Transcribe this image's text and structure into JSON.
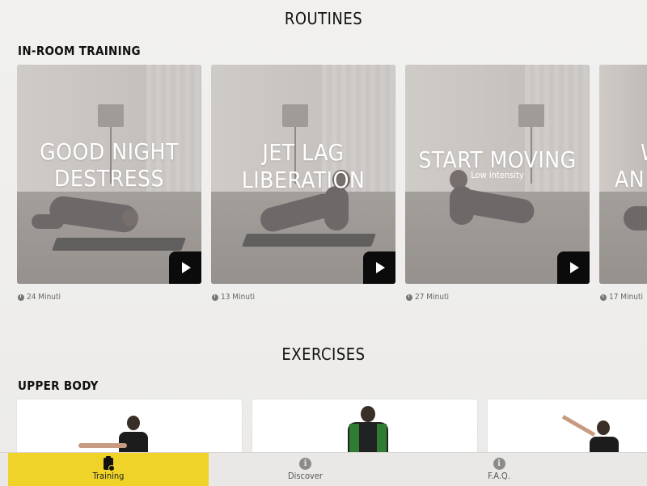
{
  "routines": {
    "title": "ROUTINES",
    "subtitle": "IN-ROOM TRAINING",
    "cards": [
      {
        "title_line1": "GOOD NIGHT",
        "title_line2": "DESTRESS",
        "subtitle": "",
        "duration": "24 Minuti"
      },
      {
        "title_line1": "JET LAG",
        "title_line2": "LIBERATION",
        "subtitle": "",
        "duration": "13 Minuti"
      },
      {
        "title_line1": "START MOVING",
        "title_line2": "",
        "subtitle": "Low intensity",
        "duration": "27 Minuti"
      },
      {
        "title_line1": "W",
        "title_line2": "AN",
        "subtitle": "",
        "duration": "17 Minuti"
      }
    ]
  },
  "exercises": {
    "title": "EXERCISES",
    "subtitle": "UPPER BODY"
  },
  "tabbar": {
    "tabs": [
      {
        "label": "Training",
        "icon": "clipboard-icon",
        "active": true
      },
      {
        "label": "Discover",
        "icon": "info-icon",
        "active": false
      },
      {
        "label": "F.A.Q.",
        "icon": "info-icon",
        "active": false
      }
    ],
    "accent": "#f0d328"
  },
  "icons": {
    "info_glyph": "i"
  }
}
